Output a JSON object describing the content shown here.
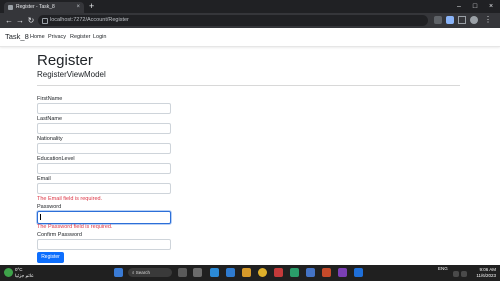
{
  "browser": {
    "tab_title": "Register - Task_8",
    "tab_close": "×",
    "new_tab": "+",
    "url": "localhost:7272/Account/Register",
    "back": "←",
    "forward": "→",
    "reload": "↻",
    "win_min": "–",
    "win_max": "□",
    "win_close": "×"
  },
  "navbar": {
    "brand": "Task_8",
    "links": [
      "Home",
      "Privacy",
      "Register",
      "Login"
    ]
  },
  "page": {
    "title": "Register",
    "subtitle": "RegisterViewModel",
    "fields": [
      {
        "label": "FirstName",
        "value": ""
      },
      {
        "label": "LastName",
        "value": ""
      },
      {
        "label": "Nationality",
        "value": ""
      },
      {
        "label": "EducationLevel",
        "value": ""
      },
      {
        "label": "Email",
        "value": "",
        "error": "The Email field is required."
      },
      {
        "label": "Password",
        "value": "",
        "error": "The Password field is required."
      },
      {
        "label": "Confirm Password",
        "value": ""
      }
    ],
    "submit_label": "Register"
  },
  "taskbar": {
    "weather_temp": "0°C",
    "weather_desc": "غائم جزئيا",
    "search_placeholder": "Search",
    "language": "ENG",
    "time": "9:06 AM",
    "date": "11/6/2023"
  },
  "colors": {
    "primary": "#0d6efd",
    "error": "#dc3545",
    "focus": "#2c6fd8",
    "chrome_dark": "#202124"
  }
}
